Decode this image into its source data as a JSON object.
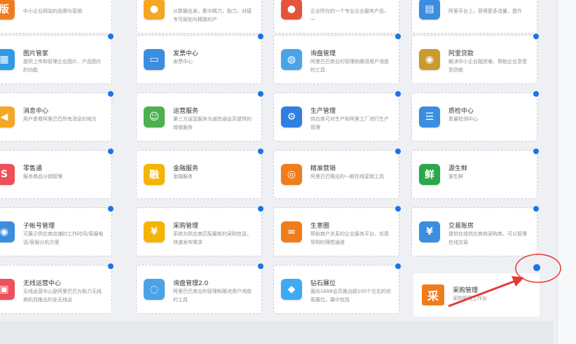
{
  "colors": {
    "accent": "#1a73e8",
    "annotation": "#e53935",
    "background": "#eef0f4"
  },
  "grid": {
    "rows": [
      [
        {
          "icon_name": "brand-icon",
          "icon_glyph": "版",
          "icon_color": "#f07c1c",
          "title": "",
          "desc": "中小企业网站的品牌与营销"
        },
        {
          "icon_name": "orange-circle-icon",
          "icon_glyph": "●",
          "icon_color": "#f5a623",
          "title": "",
          "desc": "从数据出发，集中精力，助力，对接专可规划与精致的产"
        },
        {
          "icon_name": "red-circle-icon",
          "icon_glyph": "●",
          "icon_color": "#e5533d",
          "title": "",
          "desc": "企业所在的一个专业企业服务产品，一"
        },
        {
          "icon_name": "blue-doc-icon",
          "icon_glyph": "▤",
          "icon_color": "#3b8de0",
          "title": "",
          "desc": "阿里平台上，获得更多流量，提升"
        }
      ],
      [
        {
          "icon_name": "picture-manager-icon",
          "icon_glyph": "▦",
          "icon_color": "#2f9be6",
          "title": "图片管家",
          "desc": "提供上传和管理企业图片、产品图片的功能"
        },
        {
          "icon_name": "invoice-icon",
          "icon_glyph": "▭",
          "icon_color": "#3b8de0",
          "title": "发票中心",
          "desc": "发票中心"
        },
        {
          "icon_name": "globe-icon",
          "icon_glyph": "◍",
          "icon_color": "#4aa3e8",
          "title": "询盘管理",
          "desc": "阿里巴巴商业的管理和跟进用户询盘的工具"
        },
        {
          "icon_name": "coin-icon",
          "icon_glyph": "◉",
          "icon_color": "#c99a2e",
          "title": "阿里贷款",
          "desc": "解决中小企业融资难，帮助企业享受到贷款"
        }
      ],
      [
        {
          "icon_name": "megaphone-icon",
          "icon_glyph": "◀",
          "icon_color": "#f5a623",
          "title": "消息中心",
          "desc": "用户查看阿里巴巴所有消息的地方"
        },
        {
          "icon_name": "service-agent-icon",
          "icon_glyph": "☺",
          "icon_color": "#4caf50",
          "title": "运营服务",
          "desc": "第三方运营服务为诚信通会员提供的增值服务"
        },
        {
          "icon_name": "production-gear-icon",
          "icon_glyph": "⚙",
          "icon_color": "#2f7fe0",
          "title": "生产管理",
          "desc": "供应商可对生产和阿里工厂进行生产管理"
        },
        {
          "icon_name": "checklist-icon",
          "icon_glyph": "☰",
          "icon_color": "#3b8de0",
          "title": "质检中心",
          "desc": "质量检测中心"
        }
      ],
      [
        {
          "icon_name": "payment-icon",
          "icon_glyph": "S",
          "icon_color": "#ef4f5a",
          "title": "零售通",
          "desc": "服务商品分销管理"
        },
        {
          "icon_name": "finance-icon",
          "icon_glyph": "融",
          "icon_color": "#f5b400",
          "title": "金融服务",
          "desc": "金融服务"
        },
        {
          "icon_name": "target-icon",
          "icon_glyph": "◎",
          "icon_color": "#f07c1c",
          "title": "精准营销",
          "desc": "阿里巴巴推出的一款在线营销工具"
        },
        {
          "icon_name": "fresh-icon",
          "icon_glyph": "鲜",
          "icon_color": "#2aa84a",
          "title": "源生鲜",
          "desc": "源生鲜"
        }
      ],
      [
        {
          "icon_name": "sub-account-icon",
          "icon_glyph": "◉",
          "icon_color": "#3b8de0",
          "title": "子帐号管理",
          "desc": "可展示供应商店铺的工作时间/客服电话/客服分机方便"
        },
        {
          "icon_name": "procurement-icon",
          "icon_glyph": "¥",
          "icon_color": "#f5b400",
          "title": "采购管理",
          "desc": "系统为供应商匹配最新的采购信息，快速发布需求"
        },
        {
          "icon_name": "link-icon",
          "icon_glyph": "∞",
          "icon_color": "#f07c1c",
          "title": "生意圈",
          "desc": "帮助商户关系的企业服务平台，优质导购的理想通道"
        },
        {
          "icon_name": "trade-account-icon",
          "icon_glyph": "¥",
          "icon_color": "#3b8de0",
          "title": "交易账房",
          "desc": "提供在线供应商和采购商，可以管理在线交易"
        }
      ],
      [
        {
          "icon_name": "wireless-shop-icon",
          "icon_glyph": "▣",
          "icon_color": "#ef4f5a",
          "title": "无线运营中心",
          "desc": "无线运营中心是阿里巴巴为助力无线商机而推出的全无线运"
        },
        {
          "icon_name": "inquiry-2-icon",
          "icon_glyph": "◌",
          "icon_color": "#4aa3e8",
          "title": "询盘管理2.0",
          "desc": "阿里巴巴商业的管理和跟进用户询盘的工具"
        },
        {
          "icon_name": "diamond-icon",
          "icon_glyph": "◆",
          "icon_color": "#3fa9f5",
          "title": "钻石展位",
          "desc": "面向1688会员推出超100个左右的优质展位，展中包括"
        },
        {
          "icon_name": "empty-slot-icon",
          "icon_glyph": "",
          "icon_color": "#ffffff",
          "title": "",
          "desc": ""
        }
      ]
    ]
  },
  "highlight": {
    "icon_glyph": "采",
    "title": "采购管理",
    "desc": "采购管理工作台"
  }
}
